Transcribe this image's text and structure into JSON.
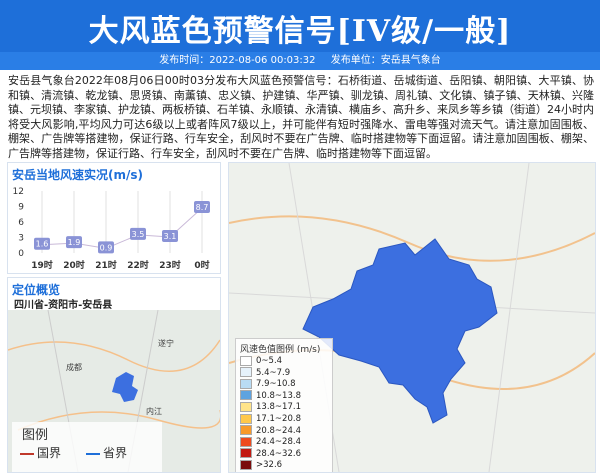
{
  "header": {
    "title": "大风蓝色预警信号[IV级/一般]",
    "publish_time": "发布时间：2022-08-06 00:03:32",
    "publisher": "发布单位：安岳县气象台"
  },
  "notice": {
    "text": "安岳县气象台2022年08月06日00时03分发布大风蓝色预警信号：石桥街道、岳城街道、岳阳镇、朝阳镇、大平镇、协和镇、清流镇、乾龙镇、思贤镇、南薰镇、忠义镇、护建镇、华严镇、驯龙镇、周礼镇、文化镇、镇子镇、天林镇、兴隆镇、元坝镇、李家镇、护龙镇、两板桥镇、石羊镇、永顺镇、永清镇、横庙乡、高升乡、来凤乡等乡镇（街道）24小时内将受大风影响,平均风力可达6级以上或者阵风7级以上，并可能伴有短时强降水、雷电等强对流天气。请注意加固围板、棚架、广告牌等搭建物，保证行路、行车安全，刮风时不要在广告牌、临时搭建物等下面逗留。请注意加固围板、棚架、广告牌等搭建物，保证行路、行车安全，刮风时不要在广告牌、临时搭建物等下面逗留。"
  },
  "wind_panel": {
    "title": "安岳当地风速实况(m/s)"
  },
  "chart_data": {
    "type": "line",
    "title": "安岳当地风速实况(m/s)",
    "categories": [
      "19时",
      "20时",
      "21时",
      "22时",
      "23时",
      "0时"
    ],
    "values": [
      1.6,
      1.9,
      0.9,
      3.5,
      3.1,
      8.7
    ],
    "value_labels": [
      "1.6",
      "1.9",
      "0.9",
      "3.5",
      "3.1",
      "8.7"
    ],
    "yticks": [
      "12",
      "9",
      "6",
      "3",
      "0"
    ],
    "ytick_values": [
      12,
      9,
      6,
      3,
      0
    ],
    "ylim": [
      0,
      12
    ],
    "color": "#8a93d6"
  },
  "location": {
    "title": "定位概览",
    "name": "四川省-资阳市-安岳县",
    "legend_title": "图例",
    "legend_national": "国界",
    "legend_province": "省界",
    "city_chengdu": "成都",
    "city_neijiang": "内江",
    "city_suining": "遂宁"
  },
  "scale": {
    "title": "风速色值图例 (m/s)",
    "items": [
      {
        "label": "0~5.4",
        "color": "#ffffff"
      },
      {
        "label": "5.4~7.9",
        "color": "#e6f2fb"
      },
      {
        "label": "7.9~10.8",
        "color": "#b9dcf4"
      },
      {
        "label": "10.8~13.8",
        "color": "#5ea3e0"
      },
      {
        "label": "13.8~17.1",
        "color": "#ffe48a"
      },
      {
        "label": "17.1~20.8",
        "color": "#ffc84a"
      },
      {
        "label": "20.8~24.4",
        "color": "#f89a2a"
      },
      {
        "label": "24.4~28.4",
        "color": "#ee4b1f"
      },
      {
        "label": "28.4~32.6",
        "color": "#c21a12"
      },
      {
        "label": ">32.6",
        "color": "#7a0c0c"
      }
    ]
  },
  "colors": {
    "header": "#1e6fd9",
    "warning_area": "#3c6fe0",
    "accent": "#1e6fd9"
  }
}
